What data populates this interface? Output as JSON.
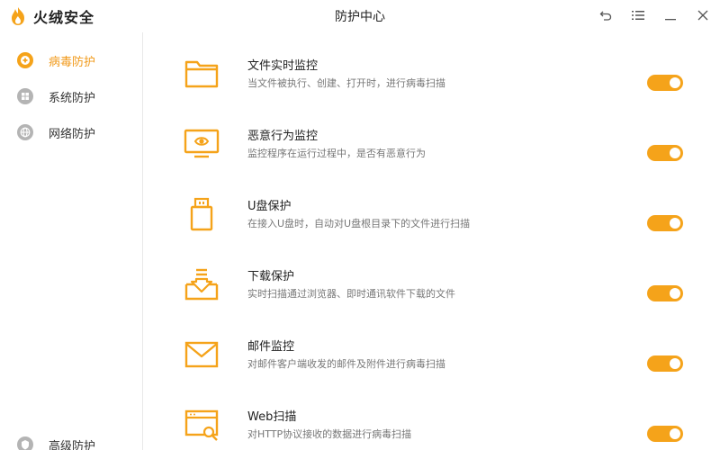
{
  "app": {
    "logo_text": "火绒安全",
    "window_title": "防护中心"
  },
  "window_controls": [
    {
      "name": "back-icon"
    },
    {
      "name": "menu-icon"
    },
    {
      "name": "minimize-icon"
    },
    {
      "name": "close-icon"
    }
  ],
  "sidebar": {
    "items": [
      {
        "label": "病毒防护",
        "icon": "virus-protection-icon",
        "active": true
      },
      {
        "label": "系统防护",
        "icon": "windows-icon",
        "active": false
      },
      {
        "label": "网络防护",
        "icon": "globe-icon",
        "active": false
      }
    ],
    "bottom_item": {
      "label": "高级防护",
      "icon": "advanced-protection-icon"
    }
  },
  "features": [
    {
      "title": "文件实时监控",
      "desc": "当文件被执行、创建、打开时，进行病毒扫描",
      "icon": "folder-icon",
      "enabled": true
    },
    {
      "title": "恶意行为监控",
      "desc": "监控程序在运行过程中，是否有恶意行为",
      "icon": "monitor-eye-icon",
      "enabled": true
    },
    {
      "title": "U盘保护",
      "desc": "在接入U盘时，自动对U盘根目录下的文件进行扫描",
      "icon": "usb-drive-icon",
      "enabled": true
    },
    {
      "title": "下载保护",
      "desc": "实时扫描通过浏览器、即时通讯软件下载的文件",
      "icon": "download-tray-icon",
      "enabled": true
    },
    {
      "title": "邮件监控",
      "desc": "对邮件客户端收发的邮件及附件进行病毒扫描",
      "icon": "mail-icon",
      "enabled": true
    },
    {
      "title": "Web扫描",
      "desc": "对HTTP协议接收的数据进行病毒扫描",
      "icon": "web-scan-icon",
      "enabled": true
    }
  ],
  "colors": {
    "accent": "#f5a31a",
    "active_text": "#f19a1b",
    "icon_gray": "#b4b4b4"
  }
}
